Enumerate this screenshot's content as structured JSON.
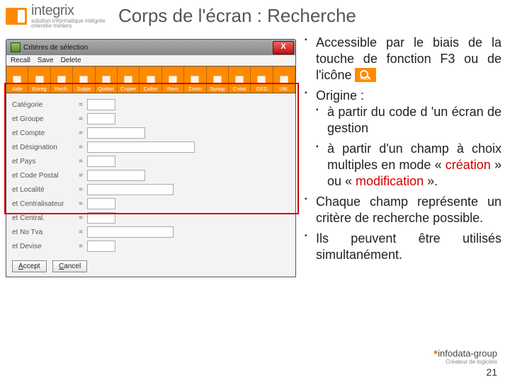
{
  "brand": {
    "name": "integrix",
    "tagline": "solution informatique intégrée",
    "tagline2": "orientée métiers"
  },
  "title": "Corps de l'écran : Recherche",
  "window": {
    "title": "Critères de sélection"
  },
  "menubar": [
    "Recall",
    "Save",
    "Delete"
  ],
  "toolbar": [
    {
      "label": "Aide"
    },
    {
      "label": "Enreg"
    },
    {
      "label": "Rech."
    },
    {
      "label": "Suppr"
    },
    {
      "label": "Quitter"
    },
    {
      "label": "Copier"
    },
    {
      "label": "Coller"
    },
    {
      "label": "Rem"
    },
    {
      "label": "Zoom"
    },
    {
      "label": "Synop"
    },
    {
      "label": "Créat"
    },
    {
      "label": "GED"
    },
    {
      "label": "Util."
    }
  ],
  "fields": [
    {
      "label": "Catégorie",
      "op": "="
    },
    {
      "label": "et Groupe",
      "op": "="
    },
    {
      "label": "et Compte",
      "op": "="
    },
    {
      "label": "et Désignation",
      "op": "="
    },
    {
      "label": "et Pays",
      "op": "="
    },
    {
      "label": "et Code Postal",
      "op": "="
    },
    {
      "label": "et Localité",
      "op": "="
    },
    {
      "label": "et Centralisateur",
      "op": "="
    },
    {
      "label": "et Central.",
      "op": "="
    },
    {
      "label": "et No Tva",
      "op": "="
    },
    {
      "label": "et Devise",
      "op": "="
    }
  ],
  "buttons": {
    "accept": "Accept",
    "cancel": "Cancel"
  },
  "text": {
    "b1a": "Accessible par le biais de la touche de fonction F3 ou de l'icône",
    "b2": "Origine :",
    "b2a": "à partir du code d 'un écran de gestion",
    "b2b_pre": "à partir d'un champ à choix multiples en mode « ",
    "b2b_c": "création",
    "b2b_mid": " » ou « ",
    "b2b_m": "modification",
    "b2b_post": "  ».",
    "b3": "Chaque champ représente un critère de recherche possible.",
    "b4": "Ils peuvent être utilisés simultanément."
  },
  "footer": {
    "brand": "infodata-group",
    "tag": "Créateur de logiciels",
    "page": "21"
  },
  "inline_icon_label": "Rech."
}
